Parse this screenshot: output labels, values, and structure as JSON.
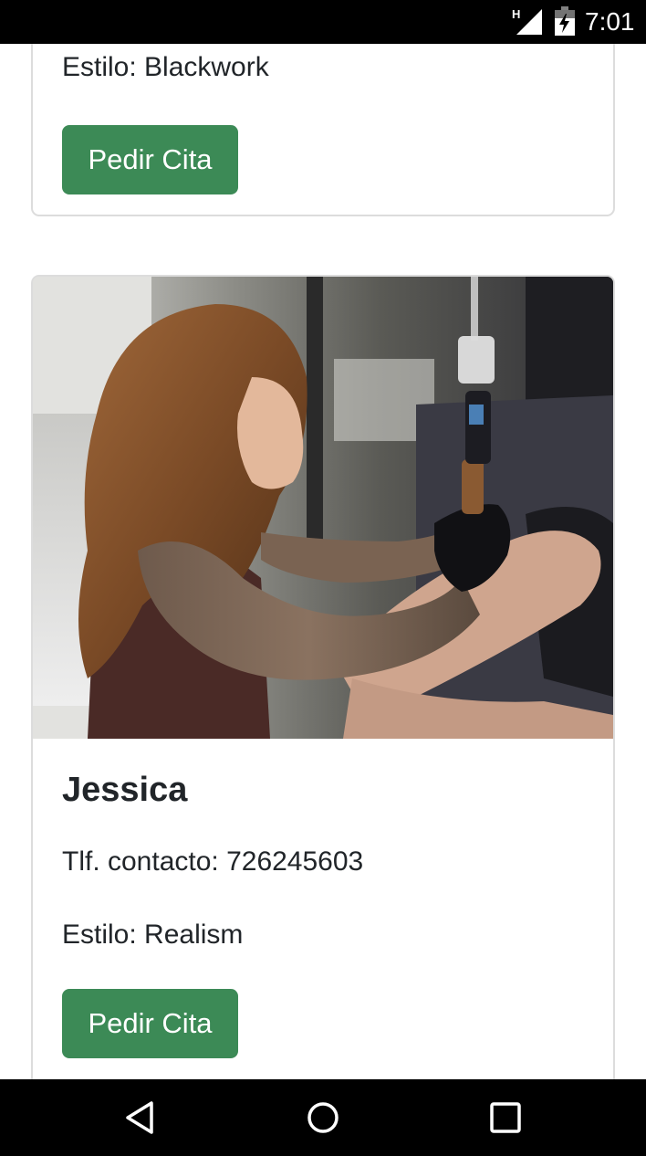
{
  "status_bar": {
    "network_label": "H",
    "time": "7:01",
    "icons": [
      "signal-icon",
      "battery-charging-icon"
    ]
  },
  "cards": [
    {
      "style": "Estilo: Blackwork",
      "button_label": "Pedir Cita"
    },
    {
      "photo": "tattoo-artist-photo",
      "name": "Jessica",
      "phone": "Tlf. contacto: 726245603",
      "style": "Estilo: Realism",
      "button_label": "Pedir Cita"
    }
  ],
  "nav_bar": {
    "icons": [
      "back-icon",
      "home-icon",
      "recents-icon"
    ]
  },
  "colors": {
    "button": "#3c8a56",
    "button_text": "#ffffff",
    "text": "#212529",
    "card_border": "#dcdcdc",
    "system_bars": "#000000"
  }
}
